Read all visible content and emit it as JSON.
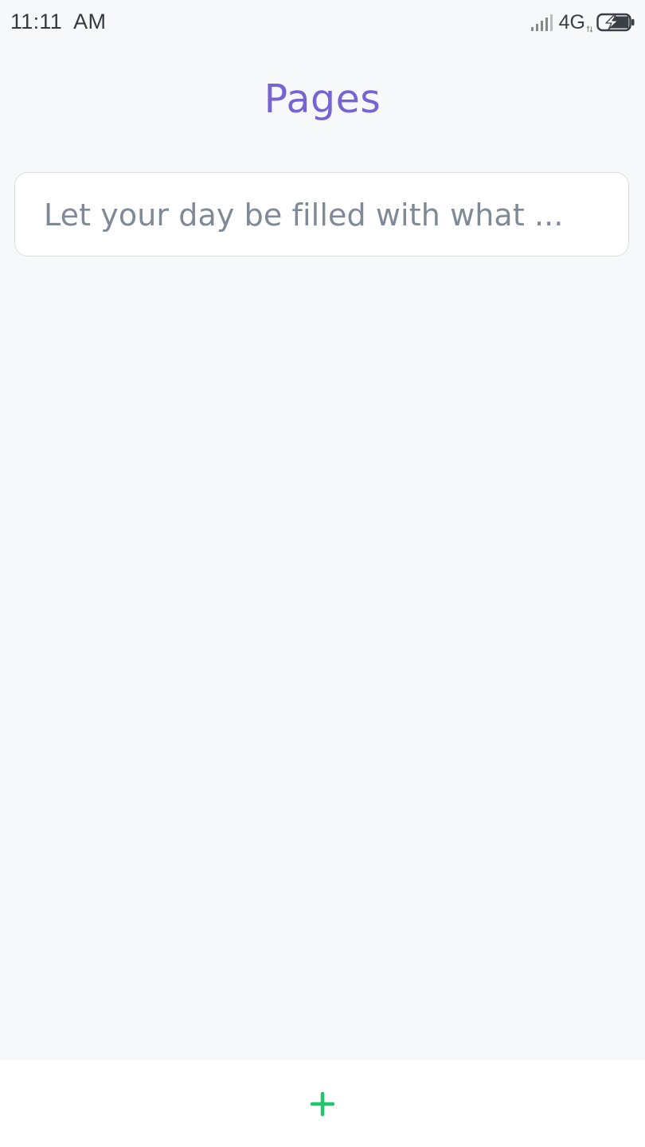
{
  "status_bar": {
    "time": "11:11  AM",
    "network": "4G",
    "icons": [
      "signal-icon",
      "network-arrows-icon",
      "battery-charging-icon"
    ]
  },
  "header": {
    "title": "Pages"
  },
  "entries": [
    {
      "text": "Let your day be filled with what ..."
    }
  ],
  "footer": {
    "add_icon": "plus-icon"
  },
  "colors": {
    "background": "#f7f8fa",
    "title": "#7863d3",
    "entry_text": "#7f8a96",
    "add_icon": "#22c56b",
    "card_border": "#d9dde2"
  }
}
